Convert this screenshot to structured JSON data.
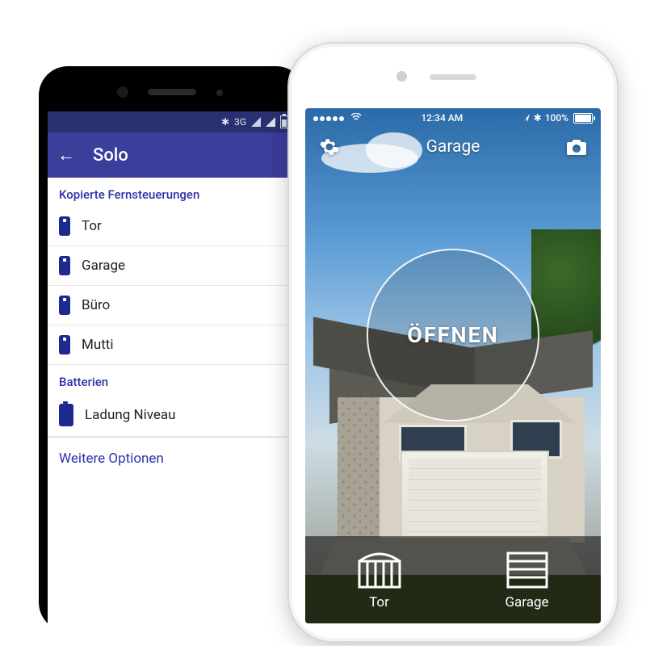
{
  "android": {
    "status": {
      "net": "3G",
      "bt": "✱"
    },
    "bar_title": "Solo",
    "sections": [
      {
        "header": "Kopierte Fernsteuerungen",
        "items": [
          "Tor",
          "Garage",
          "Büro",
          "Mutti"
        ]
      },
      {
        "header": "Batterien",
        "items": [
          "Ladung Niveau"
        ]
      }
    ],
    "more": "Weitere Optionen"
  },
  "ios": {
    "status": {
      "time": "12:34 AM",
      "batt": "100%"
    },
    "screen_title": "Garage",
    "big_button": "ÖFFNEN",
    "tabs": [
      {
        "label": "Tor"
      },
      {
        "label": "Garage"
      }
    ]
  }
}
